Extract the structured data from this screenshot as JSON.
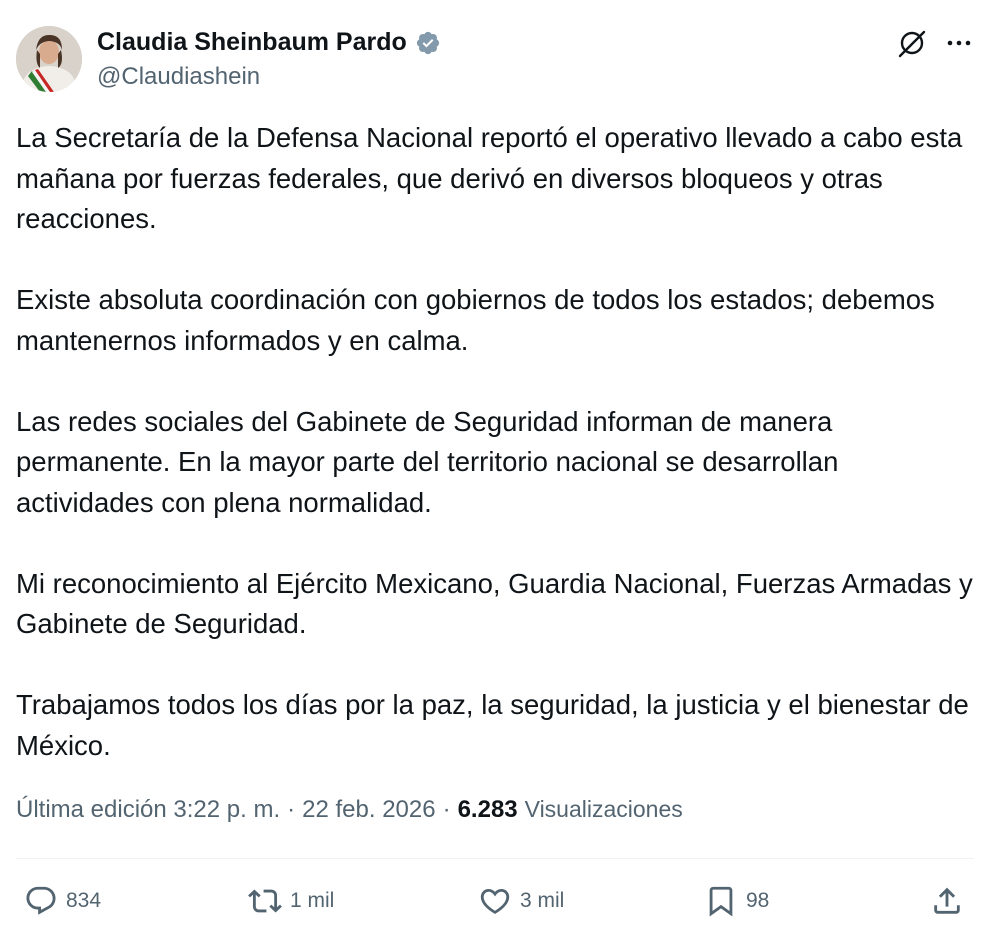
{
  "author": {
    "name": "Claudia Sheinbaum Pardo",
    "handle": "@Claudiashein",
    "verified": true,
    "verified_color": "#829aab"
  },
  "tweet": {
    "paragraphs": [
      "La Secretaría de la Defensa Nacional reportó el operativo llevado a cabo esta mañana por fuerzas federales, que derivó en diversos bloqueos y otras reacciones.",
      "Existe absoluta coordinación con gobiernos de todos los estados; debemos mantenernos informados y en calma.",
      "Las redes sociales del Gabinete de Seguridad informan de manera permanente. En la mayor parte del territorio nacional se desarrollan actividades con plena normalidad.",
      "Mi reconocimiento al Ejército Mexicano, Guardia Nacional, Fuerzas Armadas y Gabinete de Seguridad.",
      "Trabajamos todos los días por la paz, la seguridad, la justicia y el bienestar de México."
    ]
  },
  "meta": {
    "edited": "Última edición 3:22 p. m.",
    "separator": "·",
    "date": "22 feb. 2026",
    "views_count": "6.283",
    "views_label": "Visualizaciones"
  },
  "actions": {
    "replies": "834",
    "reposts": "1 mil",
    "likes": "3 mil",
    "bookmarks": "98"
  },
  "icons": {
    "header": [
      "grok-icon",
      "more-options-icon"
    ],
    "actions": [
      "reply-icon",
      "repost-icon",
      "like-icon",
      "bookmark-icon",
      "share-icon"
    ]
  },
  "colors": {
    "text_primary": "#0f1419",
    "text_secondary": "#536471",
    "divider": "#eff3f4"
  }
}
